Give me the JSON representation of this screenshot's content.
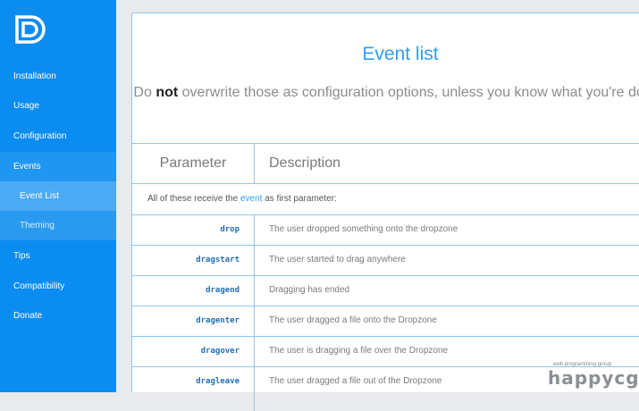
{
  "sidebar": {
    "items": [
      {
        "label": "Installation"
      },
      {
        "label": "Usage"
      },
      {
        "label": "Configuration"
      },
      {
        "label": "Events"
      },
      {
        "label": "Event List"
      },
      {
        "label": "Theming"
      },
      {
        "label": "Tips"
      },
      {
        "label": "Compatibility"
      },
      {
        "label": "Donate"
      }
    ]
  },
  "main": {
    "title": "Event list",
    "subtitle_pre": "Do ",
    "subtitle_bold": "not",
    "subtitle_post": " overwrite those as configuration options, unless you know what you're doing.",
    "table": {
      "headers": {
        "param": "Parameter",
        "desc": "Description"
      },
      "note_pre": "All of these receive the ",
      "note_link": "event",
      "note_post": " as first parameter:",
      "rows": [
        {
          "param": "drop",
          "desc": "The user dropped something onto the dropzone"
        },
        {
          "param": "dragstart",
          "desc": "The user started to drag anywhere"
        },
        {
          "param": "dragend",
          "desc": "Dragging has ended"
        },
        {
          "param": "dragenter",
          "desc": "The user dragged a file onto the Dropzone"
        },
        {
          "param": "dragover",
          "desc": "The user is dragging a file over the Dropzone"
        },
        {
          "param": "dragleave",
          "desc": "The user dragged a file out of the Dropzone"
        }
      ]
    }
  },
  "watermark": {
    "small": "web programming group",
    "big": "happycgi"
  },
  "colors": {
    "sidebar": "#0b8cf0",
    "accent": "#2f9df1",
    "code": "#1f6fb8",
    "border": "#8ec7f2"
  }
}
